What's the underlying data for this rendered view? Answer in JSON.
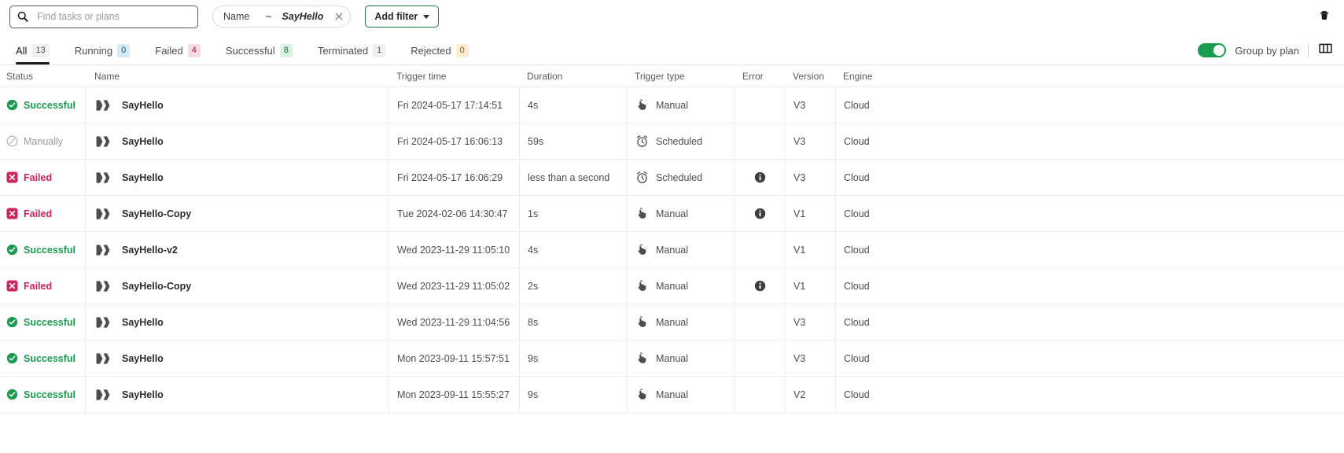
{
  "toolbar": {
    "search_placeholder": "Find tasks or plans",
    "search_value": "",
    "search_icon": "search-icon",
    "filter_pill": {
      "field": "Name",
      "operator": "~",
      "value": "SayHello",
      "remove_icon": "close-icon"
    },
    "add_filter_label": "Add filter",
    "delete_icon": "trash-icon"
  },
  "tabs": [
    {
      "label": "All",
      "count": "13",
      "badge": "b-grey",
      "active": true
    },
    {
      "label": "Running",
      "count": "0",
      "badge": "b-blue",
      "active": false
    },
    {
      "label": "Failed",
      "count": "4",
      "badge": "b-pink",
      "active": false
    },
    {
      "label": "Successful",
      "count": "8",
      "badge": "b-green",
      "active": false
    },
    {
      "label": "Terminated",
      "count": "1",
      "badge": "b-grey",
      "active": false
    },
    {
      "label": "Rejected",
      "count": "0",
      "badge": "b-orange",
      "active": false
    }
  ],
  "controls": {
    "group_by_plan_label": "Group by plan",
    "group_by_plan_on": true,
    "columns_icon": "columns-icon"
  },
  "table": {
    "columns": [
      "Status",
      "Name",
      "Trigger time",
      "Duration",
      "Trigger type",
      "Error",
      "Version",
      "Engine"
    ],
    "rows": [
      {
        "status": "Successful",
        "status_kind": "successful",
        "name": "SayHello",
        "time": "Fri 2024-05-17 17:14:51",
        "duration": "4s",
        "trigger": "Manual",
        "trigger_icon": "hand-pointer-icon",
        "error": false,
        "version": "V3",
        "engine": "Cloud"
      },
      {
        "status": "Manually",
        "status_kind": "manually",
        "name": "SayHello",
        "time": "Fri 2024-05-17 16:06:13",
        "duration": "59s",
        "trigger": "Scheduled",
        "trigger_icon": "alarm-clock-icon",
        "error": false,
        "version": "V3",
        "engine": "Cloud"
      },
      {
        "status": "Failed",
        "status_kind": "failed",
        "name": "SayHello",
        "time": "Fri 2024-05-17 16:06:29",
        "duration": "less than a second",
        "trigger": "Scheduled",
        "trigger_icon": "alarm-clock-icon",
        "error": true,
        "version": "V3",
        "engine": "Cloud"
      },
      {
        "status": "Failed",
        "status_kind": "failed",
        "name": "SayHello-Copy",
        "time": "Tue 2024-02-06 14:30:47",
        "duration": "1s",
        "trigger": "Manual",
        "trigger_icon": "hand-pointer-icon",
        "error": true,
        "version": "V1",
        "engine": "Cloud"
      },
      {
        "status": "Successful",
        "status_kind": "successful",
        "name": "SayHello-v2",
        "time": "Wed 2023-11-29 11:05:10",
        "duration": "4s",
        "trigger": "Manual",
        "trigger_icon": "hand-pointer-icon",
        "error": false,
        "version": "V1",
        "engine": "Cloud"
      },
      {
        "status": "Failed",
        "status_kind": "failed",
        "name": "SayHello-Copy",
        "time": "Wed 2023-11-29 11:05:02",
        "duration": "2s",
        "trigger": "Manual",
        "trigger_icon": "hand-pointer-icon",
        "error": true,
        "version": "V1",
        "engine": "Cloud"
      },
      {
        "status": "Successful",
        "status_kind": "successful",
        "name": "SayHello",
        "time": "Wed 2023-11-29 11:04:56",
        "duration": "8s",
        "trigger": "Manual",
        "trigger_icon": "hand-pointer-icon",
        "error": false,
        "version": "V3",
        "engine": "Cloud"
      },
      {
        "status": "Successful",
        "status_kind": "successful",
        "name": "SayHello",
        "time": "Mon 2023-09-11 15:57:51",
        "duration": "9s",
        "trigger": "Manual",
        "trigger_icon": "hand-pointer-icon",
        "error": false,
        "version": "V3",
        "engine": "Cloud"
      },
      {
        "status": "Successful",
        "status_kind": "successful",
        "name": "SayHello",
        "time": "Mon 2023-09-11 15:55:27",
        "duration": "9s",
        "trigger": "Manual",
        "trigger_icon": "hand-pointer-icon",
        "error": false,
        "version": "V2",
        "engine": "Cloud"
      }
    ]
  },
  "colors": {
    "success_green": "#1a9c4f",
    "failed_crimson": "#d1215e",
    "muted_grey": "#9b9b9b",
    "accent_border_green": "#1a7a3c"
  }
}
